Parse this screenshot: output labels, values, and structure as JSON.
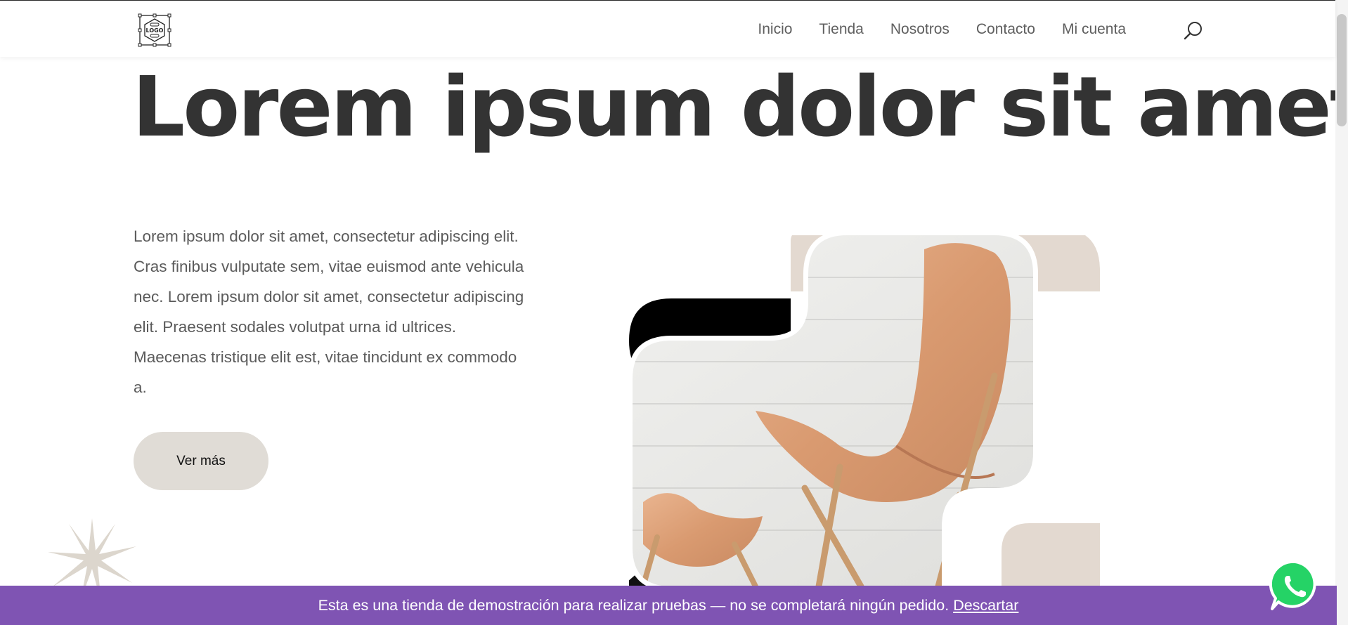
{
  "header": {
    "logo_text": "LOGO",
    "nav": [
      {
        "label": "Inicio"
      },
      {
        "label": "Tienda"
      },
      {
        "label": "Nosotros"
      },
      {
        "label": "Contacto"
      },
      {
        "label": "Mi cuenta"
      }
    ],
    "search_icon": "search-icon"
  },
  "hero": {
    "title": "Lorem ipsum dolor sit amet",
    "text": "Lorem ipsum dolor sit amet, consectetur adipiscing elit. Cras finibus vulputate sem, vitae euismod ante vehicula nec. Lorem ipsum dolor sit amet, consectetur adipiscing elit. Praesent sodales volutpat urna id ultrices. Maecenas tristique elit est, vitae tincidunt ex commodo a.",
    "button_label": "Ver más"
  },
  "banner": {
    "text": "Esta es una tienda de demostración para realizar pruebas — no se completará ningún pedido.",
    "dismiss": "Descartar"
  },
  "colors": {
    "banner_bg": "#7f54b3",
    "title": "#333333",
    "body_text": "#5b5b5b",
    "button_bg": "#e0dcd6",
    "whatsapp": "#25d366"
  },
  "icons": {
    "whatsapp": "whatsapp-icon",
    "decoration": "star-burst-icon"
  }
}
